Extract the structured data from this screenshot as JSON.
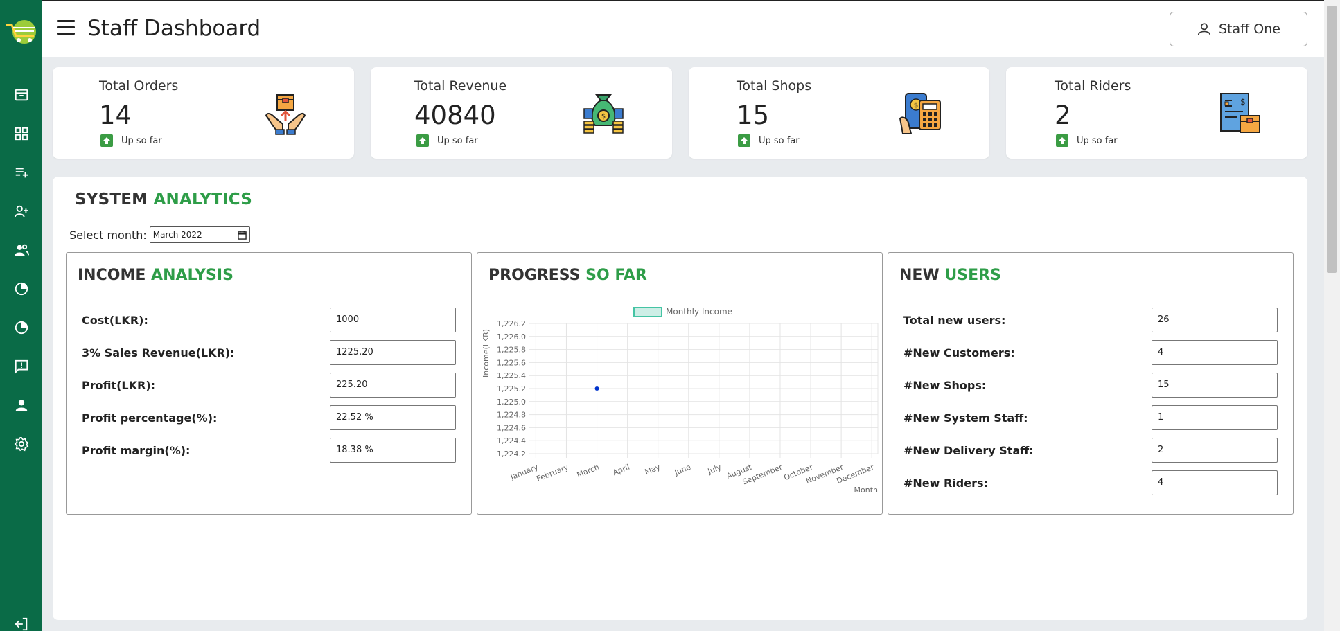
{
  "header": {
    "title": "Staff Dashboard",
    "user_name": "Staff One"
  },
  "sidebar": {
    "items": [
      {
        "icon": "inbox-icon"
      },
      {
        "icon": "grid-icon"
      },
      {
        "icon": "playlist-add-icon"
      },
      {
        "icon": "person-add-icon"
      },
      {
        "icon": "people-icon"
      },
      {
        "icon": "pie-chart-icon"
      },
      {
        "icon": "pie-chart-icon"
      },
      {
        "icon": "feedback-icon"
      },
      {
        "icon": "person-icon"
      },
      {
        "icon": "gear-icon"
      },
      {
        "icon": "logout-icon"
      }
    ]
  },
  "stats": [
    {
      "title": "Total Orders",
      "value": "14",
      "trend": "Up so far",
      "icon": "order-box-icon"
    },
    {
      "title": "Total Revenue",
      "value": "40840",
      "trend": "Up so far",
      "icon": "money-bag-icon"
    },
    {
      "title": "Total Shops",
      "value": "15",
      "trend": "Up so far",
      "icon": "shop-calculator-icon"
    },
    {
      "title": "Total Riders",
      "value": "2",
      "trend": "Up so far",
      "icon": "rider-invoice-icon"
    }
  ],
  "analytics": {
    "title_a": "SYSTEM",
    "title_b": "ANALYTICS",
    "month_label": "Select month:",
    "month_value": "March  2022"
  },
  "income": {
    "title_a": "INCOME",
    "title_b": "ANALYSIS",
    "rows": [
      {
        "label": "Cost(LKR):",
        "value": "1000"
      },
      {
        "label": "3% Sales Revenue(LKR):",
        "value": "1225.20"
      },
      {
        "label": "Profit(LKR):",
        "value": "225.20"
      },
      {
        "label": "Profit percentage(%):",
        "value": "22.52 %"
      },
      {
        "label": "Profit margin(%):",
        "value": "18.38 %"
      }
    ]
  },
  "progress": {
    "title_a": "PROGRESS",
    "title_b": "SO FAR"
  },
  "users": {
    "title_a": "NEW",
    "title_b": "USERS",
    "rows": [
      {
        "label": "Total new users:",
        "value": "26"
      },
      {
        "label": "#New Customers:",
        "value": "4"
      },
      {
        "label": "#New Shops:",
        "value": "15"
      },
      {
        "label": "#New System Staff:",
        "value": "1"
      },
      {
        "label": "#New Delivery Staff:",
        "value": "2"
      },
      {
        "label": "#New Riders:",
        "value": "4"
      }
    ]
  },
  "chart_data": {
    "type": "line",
    "categories": [
      "January",
      "February",
      "March",
      "April",
      "May",
      "June",
      "July",
      "August",
      "September",
      "October",
      "November",
      "December"
    ],
    "series": [
      {
        "name": "Monthly Income",
        "values": [
          null,
          null,
          1225.2,
          null,
          null,
          null,
          null,
          null,
          null,
          null,
          null,
          null
        ],
        "color": "#0033cc",
        "legend_color": "#45c4a4"
      }
    ],
    "ylabel": "Income(LKR)",
    "xlabel": "Month",
    "yticks": [
      1226.2,
      1226.0,
      1225.8,
      1225.6,
      1225.4,
      1225.2,
      1225.0,
      1224.8,
      1224.6,
      1224.4,
      1224.2
    ],
    "ylim": [
      1224.2,
      1226.2
    ],
    "legend": "top-center",
    "grid": true
  },
  "colors": {
    "sidebar": "#0a6b47",
    "accent_green": "#2e9d48",
    "background": "#e8ebee"
  }
}
